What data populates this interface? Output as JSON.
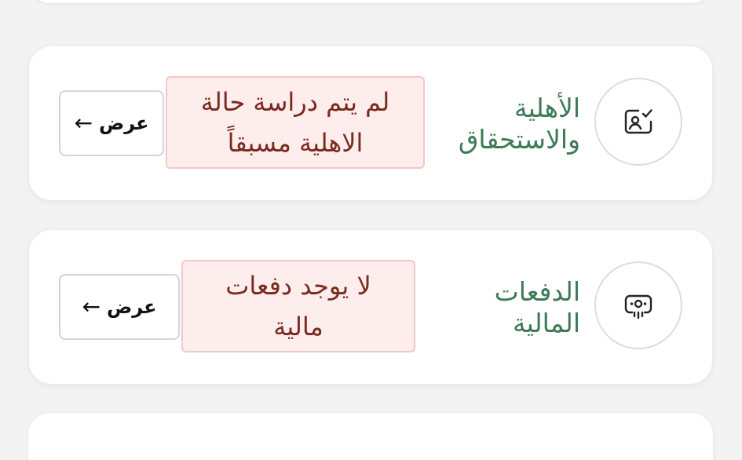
{
  "cards": [
    {
      "title": "الأهلية\nوالاستحقاق",
      "status": "لم يتم دراسة حالة\nالاهلية مسبقاً",
      "button_label": "عرض",
      "icon": "id-check-icon"
    },
    {
      "title": "الدفعات\nالمالية",
      "status": "لا يوجد دفعات\nمالية",
      "button_label": "عرض",
      "icon": "payment-terminal-icon"
    }
  ],
  "arrow_glyph": "←",
  "colors": {
    "title": "#3d7a55",
    "status_text": "#7b2a1f",
    "status_bg": "#fdeeed",
    "status_border": "#f2c9c5"
  }
}
